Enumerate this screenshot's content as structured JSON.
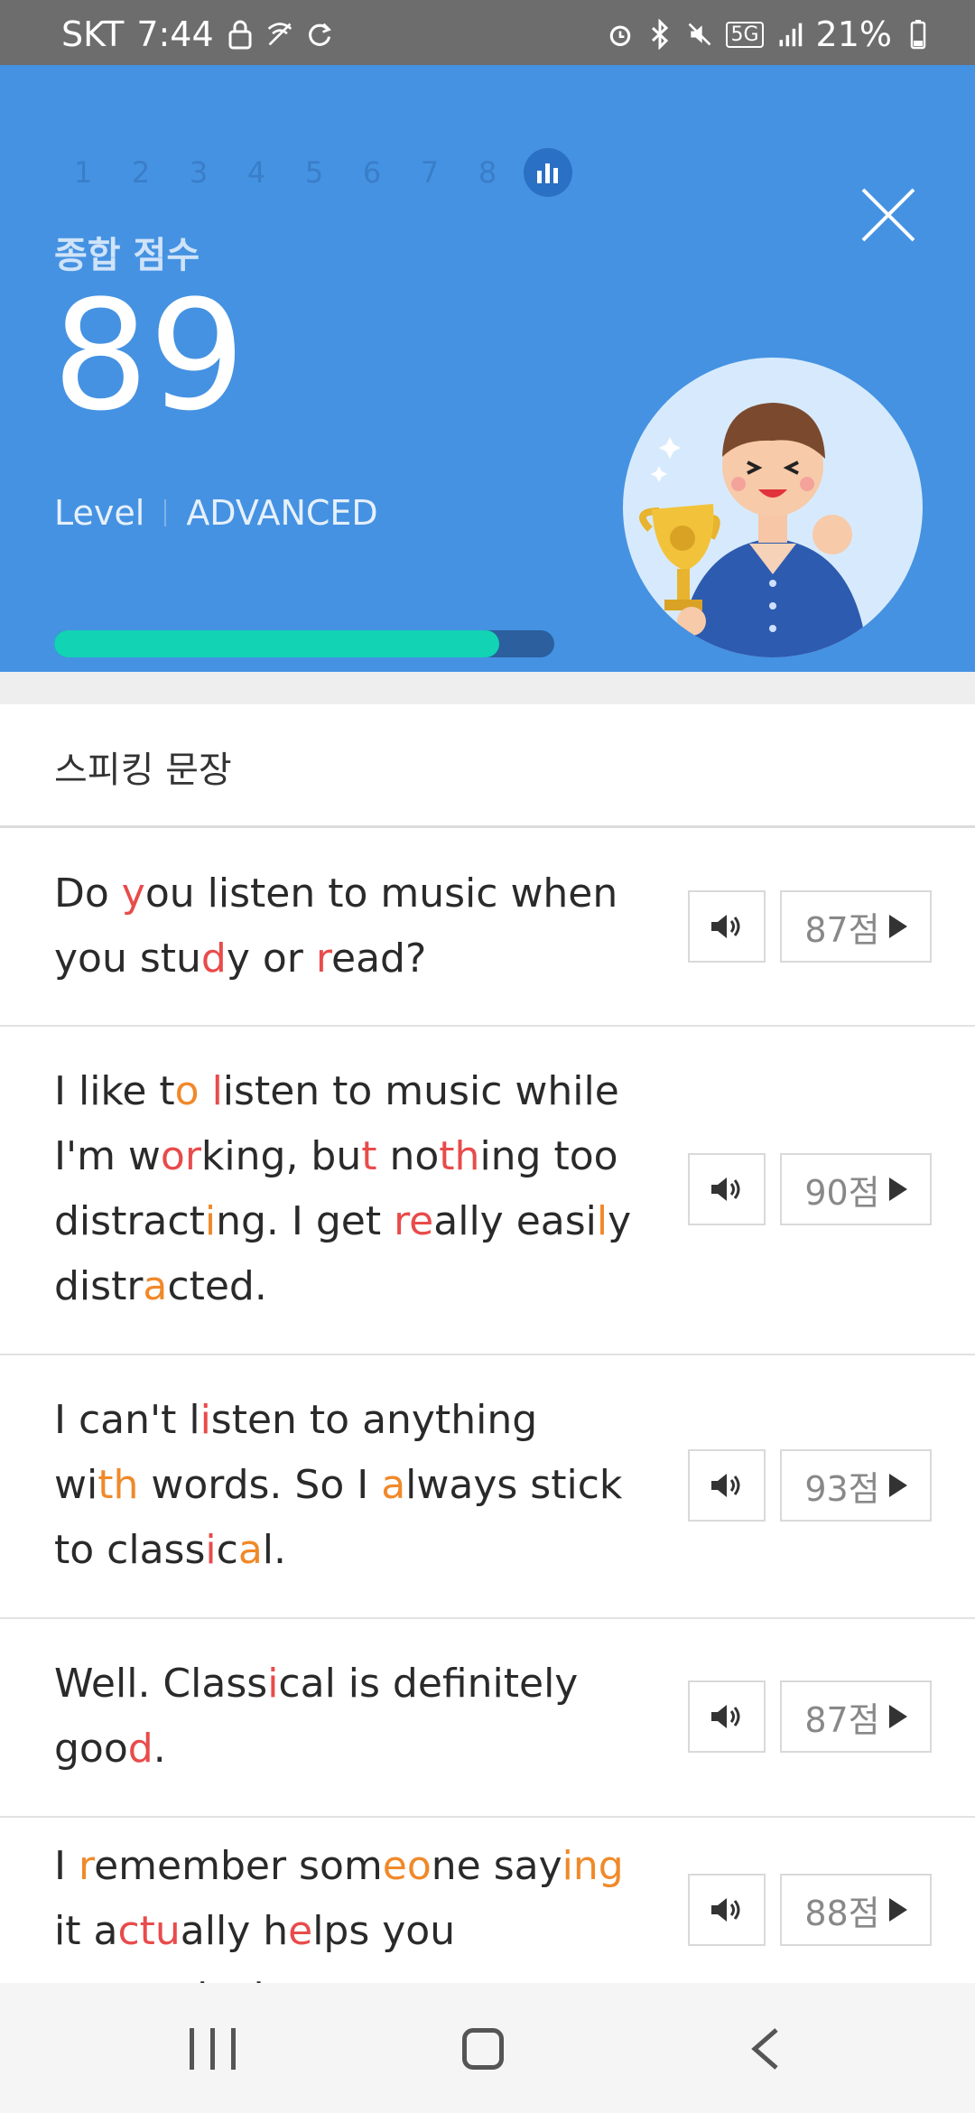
{
  "status_bar": {
    "carrier": "SKT",
    "time": "7:44",
    "network": "5G",
    "battery": "21%",
    "icons": [
      "lock-icon",
      "wifi-off-icon",
      "sync-icon",
      "alarm-icon",
      "bluetooth-icon",
      "mute-icon",
      "signal-icon",
      "battery-icon"
    ]
  },
  "header": {
    "steps": [
      "1",
      "2",
      "3",
      "4",
      "5",
      "6",
      "7",
      "8"
    ],
    "current_step_icon": "bar-chart-icon",
    "score_label": "종합 점수",
    "score": "89",
    "level_label": "Level",
    "level_value": "ADVANCED",
    "progress": 0.89,
    "colors": {
      "background": "#4592e2",
      "progress_fill": "#12d3b4",
      "progress_track": "#2b5f9e"
    }
  },
  "section": {
    "title": "스피킹 문장"
  },
  "sentences": [
    {
      "parts": [
        [
          "Do ",
          ""
        ],
        [
          "y",
          "r"
        ],
        [
          "ou listen to music when you stu",
          ""
        ],
        [
          "d",
          "r"
        ],
        [
          "y or ",
          ""
        ],
        [
          "r",
          "r"
        ],
        [
          "ead?",
          ""
        ]
      ],
      "score": "87점"
    },
    {
      "parts": [
        [
          "I like t",
          ""
        ],
        [
          "o",
          "o"
        ],
        [
          " ",
          ""
        ],
        [
          "l",
          "r"
        ],
        [
          "isten to music while I'm w",
          ""
        ],
        [
          "or",
          "r"
        ],
        [
          "king, bu",
          ""
        ],
        [
          "t",
          "r"
        ],
        [
          " no",
          ""
        ],
        [
          "th",
          "r"
        ],
        [
          "ing too distract",
          ""
        ],
        [
          "i",
          "o"
        ],
        [
          "ng. I get ",
          ""
        ],
        [
          "re",
          "r"
        ],
        [
          "ally easi",
          ""
        ],
        [
          "l",
          "o"
        ],
        [
          "y distr",
          ""
        ],
        [
          "a",
          "o"
        ],
        [
          "cted.",
          ""
        ]
      ],
      "score": "90점"
    },
    {
      "parts": [
        [
          "I can't l",
          ""
        ],
        [
          "i",
          "r"
        ],
        [
          "sten to anything wi",
          ""
        ],
        [
          "th",
          "o"
        ],
        [
          " words. So I ",
          ""
        ],
        [
          "a",
          "o"
        ],
        [
          "lways stick to class",
          ""
        ],
        [
          "i",
          "r"
        ],
        [
          "c",
          ""
        ],
        [
          "a",
          "o"
        ],
        [
          "l.",
          ""
        ]
      ],
      "score": "93점"
    },
    {
      "parts": [
        [
          "Well. Class",
          ""
        ],
        [
          "i",
          "r"
        ],
        [
          "cal is definitely goo",
          ""
        ],
        [
          "d",
          "r"
        ],
        [
          ".",
          ""
        ]
      ],
      "score": "87점"
    },
    {
      "parts": [
        [
          "I ",
          ""
        ],
        [
          "r",
          "o"
        ],
        [
          "emember som",
          ""
        ],
        [
          "eo",
          "o"
        ],
        [
          "ne say",
          ""
        ],
        [
          "ing",
          "o"
        ],
        [
          " it a",
          ""
        ],
        [
          "ctu",
          "r"
        ],
        [
          "ally h",
          ""
        ],
        [
          "e",
          "r"
        ],
        [
          "lps you concentr",
          ""
        ],
        [
          "a",
          "r"
        ],
        [
          "te",
          ""
        ]
      ],
      "score": "88점"
    }
  ],
  "colors": {
    "highlight_red": "#e84b4b",
    "highlight_orange": "#f0892a"
  }
}
